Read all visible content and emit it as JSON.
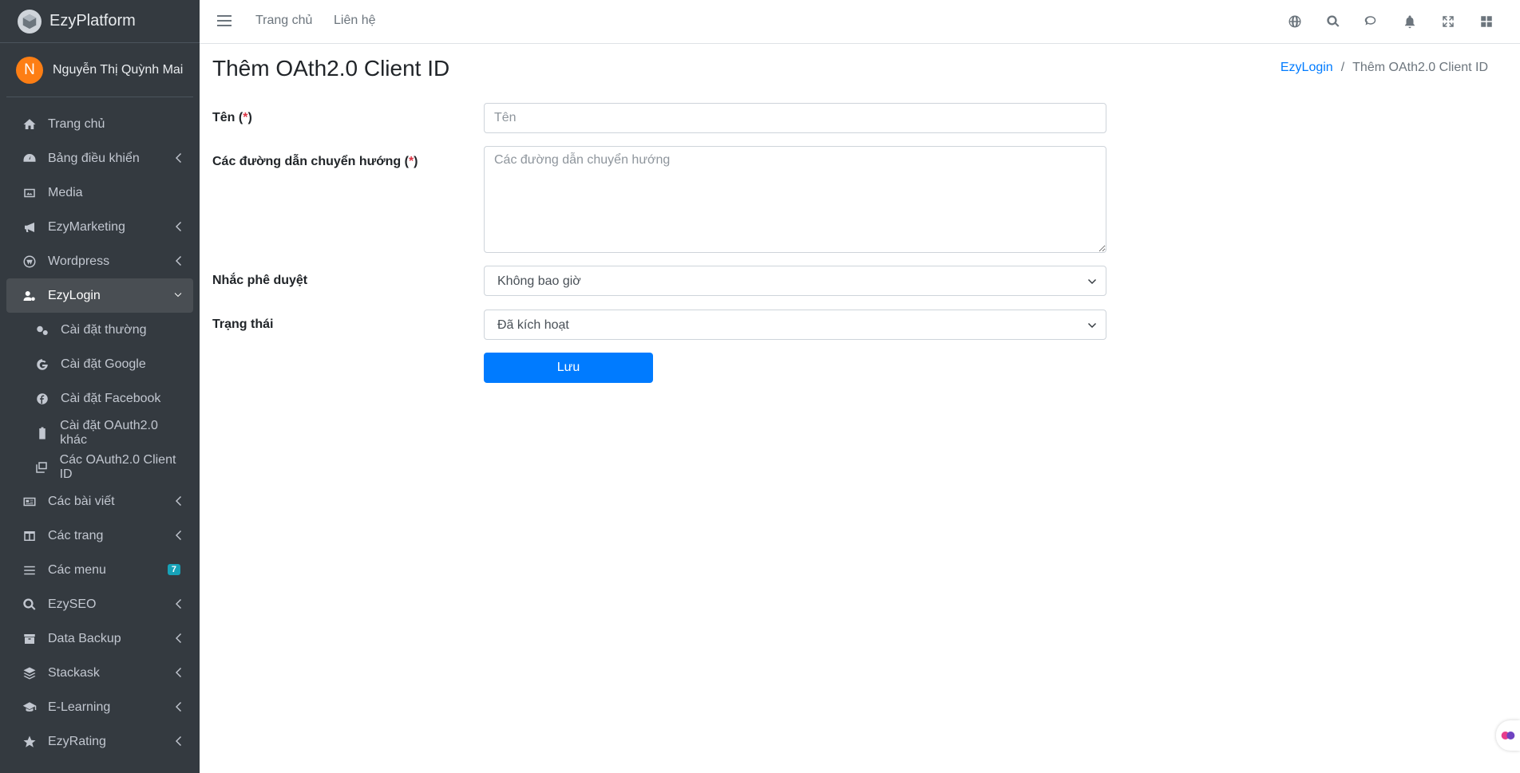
{
  "brand": {
    "name": "EzyPlatform"
  },
  "user": {
    "initial": "N",
    "name": "Nguyễn Thị Quỳnh Mai"
  },
  "sidebar": {
    "items": [
      {
        "label": "Trang chủ",
        "icon": "home-icon"
      },
      {
        "label": "Bảng điều khiển",
        "icon": "dashboard-icon"
      },
      {
        "label": "Media",
        "icon": "image-icon"
      },
      {
        "label": "EzyMarketing",
        "icon": "bullhorn-icon"
      },
      {
        "label": "Wordpress",
        "icon": "wordpress-icon"
      },
      {
        "label": "EzyLogin",
        "icon": "user-gear-icon"
      },
      {
        "label": "Cài đặt thường",
        "icon": "gears-icon"
      },
      {
        "label": "Cài đặt Google",
        "icon": "google-icon"
      },
      {
        "label": "Cài đặt Facebook",
        "icon": "facebook-icon"
      },
      {
        "label": "Cài đặt OAuth2.0 khác",
        "icon": "clipboard-icon"
      },
      {
        "label": "Các OAuth2.0 Client ID",
        "icon": "windows-icon"
      },
      {
        "label": "Các bài viết",
        "icon": "newspaper-icon"
      },
      {
        "label": "Các trang",
        "icon": "columns-icon"
      },
      {
        "label": "Các menu",
        "icon": "bars-icon",
        "badge": "7"
      },
      {
        "label": "EzySEO",
        "icon": "search-plus-icon"
      },
      {
        "label": "Data Backup",
        "icon": "archive-icon"
      },
      {
        "label": "Stackask",
        "icon": "layers-icon"
      },
      {
        "label": "E-Learning",
        "icon": "graduation-cap-icon"
      },
      {
        "label": "EzyRating",
        "icon": "star-icon"
      }
    ]
  },
  "header": {
    "nav": [
      "Trang chủ",
      "Liên hệ"
    ],
    "icons": [
      "globe-icon",
      "search-icon",
      "comments-icon",
      "bell-icon",
      "expand-icon",
      "apps-icon"
    ]
  },
  "page": {
    "title": "Thêm OAth2.0 Client ID",
    "breadcrumb": [
      "EzyLogin",
      "Thêm OAth2.0 Client ID"
    ]
  },
  "form": {
    "name_label": "Tên",
    "name_placeholder": "Tên",
    "redirect_label": "Các đường dẫn chuyển hướng",
    "redirect_placeholder": "Các đường dẫn chuyển hướng",
    "approval_label": "Nhắc phê duyệt",
    "approval_value": "Không bao giờ",
    "status_label": "Trạng thái",
    "status_value": "Đã kích hoạt",
    "required_mark": "*",
    "save_label": "Lưu"
  },
  "colors": {
    "sidebar": "#343a40",
    "primary": "#007bff",
    "avatar": "#fd7e14",
    "badge": "#17a2b8"
  }
}
